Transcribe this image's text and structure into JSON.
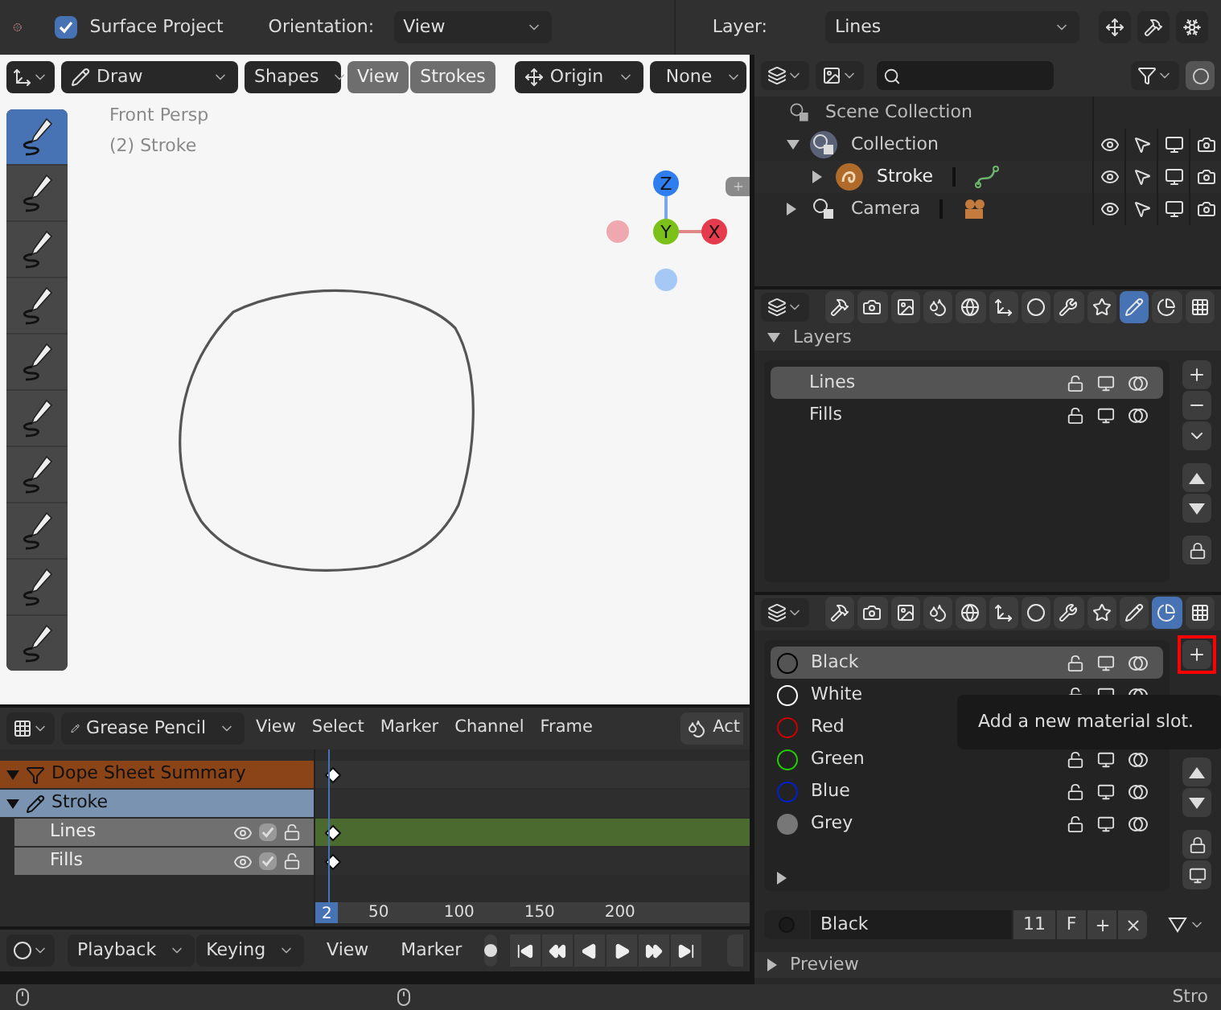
{
  "top_bar": {
    "surface_project": {
      "label": "Surface Project",
      "checked": true
    },
    "orientation_label": "Orientation:",
    "orientation_value": "View",
    "layer_label": "Layer:",
    "layer_value": "Lines"
  },
  "viewport": {
    "header": {
      "mode": "Draw",
      "shapes": "Shapes",
      "toggles": [
        "View",
        "Strokes"
      ],
      "pivot": "Origin",
      "lock": "None"
    },
    "tools": [
      {
        "selected": true
      },
      {
        "selected": false
      },
      {
        "selected": false
      },
      {
        "selected": false
      },
      {
        "selected": false
      },
      {
        "selected": false
      },
      {
        "selected": false
      },
      {
        "selected": false
      },
      {
        "selected": false
      },
      {
        "selected": false
      }
    ],
    "overlay_lines": [
      "Front Persp",
      "(2) Stroke"
    ],
    "gizmo": {
      "z": "Z",
      "y": "Y",
      "x": "X"
    }
  },
  "outliner": {
    "root": "Scene Collection",
    "items": [
      {
        "label": "Collection",
        "kind": "collection",
        "expanded": true,
        "children": [
          {
            "label": "Stroke",
            "kind": "gpencil",
            "expanded": false,
            "data": {
              "kind": "stroke"
            }
          }
        ]
      },
      {
        "label": "Camera",
        "kind": "collection",
        "expanded": false,
        "data": {
          "kind": "camera"
        }
      }
    ]
  },
  "layers_panel": {
    "tabs": [
      {
        "selected": false
      },
      {
        "selected": false
      },
      {
        "selected": false
      },
      {
        "selected": false
      },
      {
        "selected": false
      },
      {
        "selected": false
      },
      {
        "selected": false
      },
      {
        "selected": false
      },
      {
        "selected": false
      },
      {
        "selected": true
      },
      {
        "selected": false
      },
      {
        "selected": false
      }
    ],
    "title": "Layers",
    "expanded": true,
    "layers": [
      {
        "name": "Lines",
        "selected": true
      },
      {
        "name": "Fills",
        "selected": false
      }
    ]
  },
  "materials_panel": {
    "tabs": [
      {
        "selected": false
      },
      {
        "selected": false
      },
      {
        "selected": false
      },
      {
        "selected": false
      },
      {
        "selected": false
      },
      {
        "selected": false
      },
      {
        "selected": false
      },
      {
        "selected": false
      },
      {
        "selected": false
      },
      {
        "selected": false
      },
      {
        "selected": true
      },
      {
        "selected": false
      }
    ],
    "materials": [
      {
        "name": "Black",
        "color": "#000000",
        "kind": "ring",
        "selected": true
      },
      {
        "name": "White",
        "color": "#ffffff",
        "kind": "ring",
        "selected": false
      },
      {
        "name": "Red",
        "color": "#cc0000",
        "kind": "ring",
        "selected": false
      },
      {
        "name": "Green",
        "color": "#22cc00",
        "kind": "ring",
        "selected": false
      },
      {
        "name": "Blue",
        "color": "#0022cc",
        "kind": "ring",
        "selected": false
      },
      {
        "name": "Grey",
        "color": "#777777",
        "kind": "disc",
        "selected": false
      }
    ],
    "active_name": "Black",
    "users": "11",
    "fake_user": "F",
    "tooltip": "Add a new material slot.",
    "preview_label": "Preview"
  },
  "dope_sheet": {
    "mode": "Grease Pencil",
    "menus": [
      "View",
      "Select",
      "Marker",
      "Channel",
      "Frame"
    ],
    "action_label": "Act",
    "channels": [
      {
        "name": "Dope Sheet Summary",
        "kind": "summary"
      },
      {
        "name": "Stroke",
        "kind": "object"
      },
      {
        "name": "Lines",
        "kind": "layer",
        "selected": true,
        "checked": true
      },
      {
        "name": "Fills",
        "kind": "layer",
        "selected": false,
        "checked": true
      }
    ],
    "current_frame": "2",
    "ruler": [
      "50",
      "100",
      "150",
      "200"
    ]
  },
  "timeline": {
    "dropdowns": [
      "Playback",
      "Keying"
    ],
    "menus": [
      "View",
      "Marker"
    ]
  },
  "status_bar": {
    "text": "Stro"
  }
}
